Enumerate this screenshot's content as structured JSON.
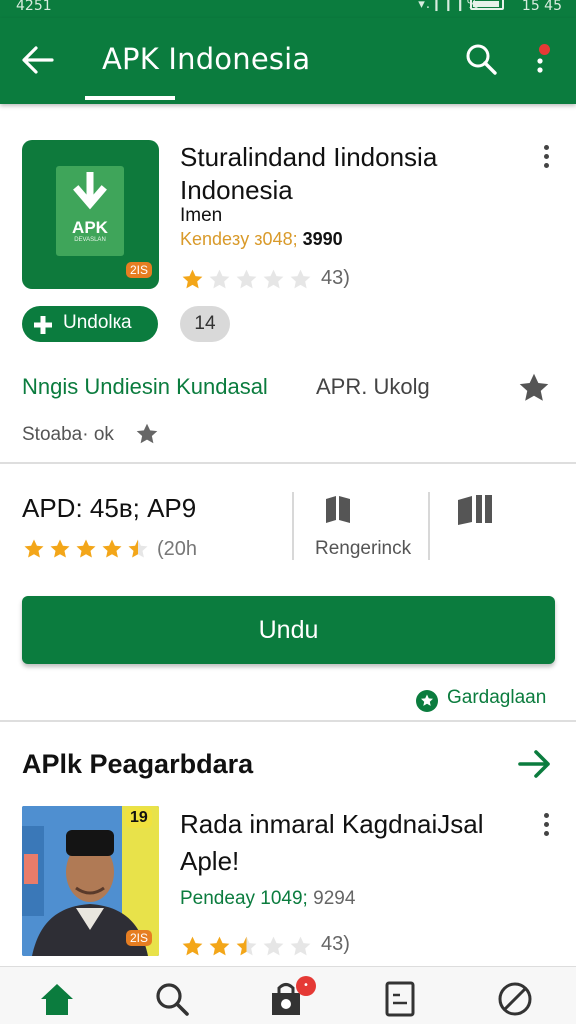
{
  "status_bar": {
    "time_left": "4251",
    "time_right": "15 45",
    "signal_text": "▾.❙❙❙%"
  },
  "app_bar": {
    "title": "APK Indonesia"
  },
  "app": {
    "title": "Sturalindand Iindonsia Indonesia",
    "developer": "Imen",
    "meta": "Kendeзy з048;",
    "meta_strong": "3990",
    "icon_text": "APK",
    "icon_subtext": "DEVASLAN",
    "age_badge": "2ІЅ",
    "rating_stars": 1,
    "rating_count": "43)",
    "install_label": "Undolкa",
    "count_pill": "14"
  },
  "developer_row": {
    "link": "Nngis Undiesin Kundasal",
    "tag": "APR. Ukolg"
  },
  "storage": {
    "text": "Stoaba· оk"
  },
  "stats": {
    "rating_label": "APD: 45в; AP9",
    "rating_stars": 4.5,
    "reviews": "(20h",
    "rank_label": "Rengerinck"
  },
  "install_button": {
    "label": "Undu"
  },
  "gardaglaan": {
    "label": "Gardaglaan"
  },
  "section": {
    "title": "APlk Peagarbdara"
  },
  "card": {
    "title": "Rada inmaral KagdnaiJsal Aple!",
    "meta": "Pendeay 1049;",
    "meta_gray": "9294",
    "number_badge": "19",
    "age_badge": "2ІЅ",
    "rating_stars": 2.5,
    "rating_count": "43)"
  },
  "bottom_nav": {
    "items": [
      "home",
      "search",
      "store",
      "library",
      "blocked"
    ],
    "badge": "•"
  },
  "colors": {
    "primary": "#0b7c3e",
    "star": "#f3a619",
    "badge": "#e53935"
  }
}
